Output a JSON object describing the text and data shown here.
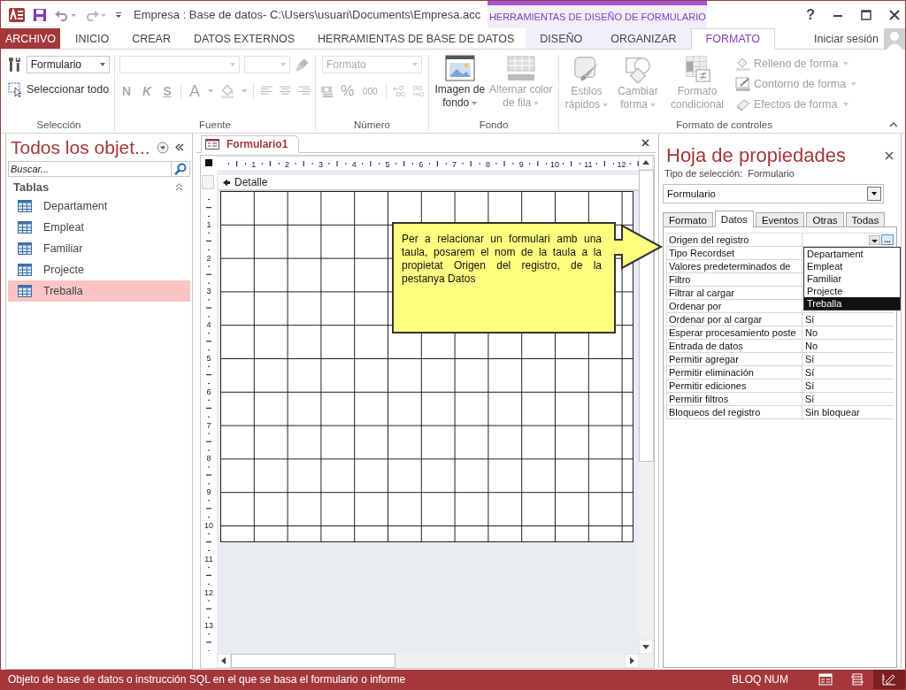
{
  "window": {
    "title": "Empresa : Base de datos- C:\\Users\\usuari\\Documents\\Empresa.acc",
    "context_label": "HERRAMIENTAS DE DISEÑO DE FORMULARIO",
    "help": "?"
  },
  "ribbon_tabs": [
    {
      "label": "ARCHIVO",
      "kind": "file",
      "selected": false
    },
    {
      "label": "INICIO",
      "kind": "main",
      "selected": false
    },
    {
      "label": "CREAR",
      "kind": "main",
      "selected": false
    },
    {
      "label": "DATOS EXTERNOS",
      "kind": "main",
      "selected": false
    },
    {
      "label": "HERRAMIENTAS DE BASE DE DATOS",
      "kind": "main",
      "selected": false
    },
    {
      "label": "DISEÑO",
      "kind": "context",
      "selected": false
    },
    {
      "label": "ORGANIZAR",
      "kind": "context",
      "selected": false
    },
    {
      "label": "FORMATO",
      "kind": "context",
      "selected": true
    }
  ],
  "account": "Iniciar sesión",
  "ribbon": {
    "seleccion": {
      "label": "Selección",
      "combo": "Formulario",
      "select_all": "Seleccionar todo"
    },
    "fuente": {
      "label": "Fuente",
      "style_buttons": [
        "N",
        "K",
        "S"
      ],
      "color_button": "A",
      "disabled": true
    },
    "numero": {
      "label": "Número",
      "combo": "Formato",
      "symbols": [
        "%",
        "000"
      ],
      "disabled": true
    },
    "fondo": {
      "label": "Fondo",
      "buttons": [
        {
          "label": "Imagen de fondo",
          "kind": "image",
          "disabled": false
        },
        {
          "label": "Alternar color de fila",
          "kind": "rows",
          "disabled": true
        }
      ]
    },
    "controles": {
      "label": "Formato de controles",
      "large": [
        {
          "label": "Estilos rápidos",
          "kind": "styles",
          "disabled": true
        },
        {
          "label": "Cambiar forma",
          "kind": "shapes",
          "disabled": true
        },
        {
          "label": "Formato condicional",
          "kind": "conditional",
          "disabled": true
        }
      ],
      "small": [
        {
          "label": "Relleno de forma",
          "kind": "fill",
          "disabled": true
        },
        {
          "label": "Contorno de forma",
          "kind": "outline",
          "disabled": true
        },
        {
          "label": "Efectos de forma",
          "kind": "effects",
          "disabled": true
        }
      ]
    }
  },
  "navigation": {
    "title": "Todos los objet...",
    "search_placeholder": "Buscar...",
    "group": "Tablas",
    "items": [
      {
        "label": "Departament",
        "selected": false
      },
      {
        "label": "Empleat",
        "selected": false
      },
      {
        "label": "Familiar",
        "selected": false
      },
      {
        "label": "Projecte",
        "selected": false
      },
      {
        "label": "Treballa",
        "selected": true
      }
    ]
  },
  "document_tab": "Formulario1",
  "designer": {
    "section": "Detalle",
    "ruler_h": [
      "1",
      "2",
      "3",
      "4",
      "5",
      "6",
      "7",
      "8",
      "9",
      "10",
      "11",
      "12"
    ],
    "ruler_v": [
      "1",
      "2",
      "3",
      "4",
      "5",
      "6",
      "7",
      "8",
      "9",
      "10",
      "11",
      "12",
      "13"
    ]
  },
  "callout": "Per a relacionar un formulari amb una taula, posarem el nom de la taula a la propietat Origen del registro, de la pestanya Datos",
  "property_sheet": {
    "title": "Hoja de propiedades",
    "selection_label": "Tipo de selección:",
    "selection_type": "Formulario",
    "object": "Formulario",
    "tabs": [
      {
        "label": "Formato",
        "selected": false
      },
      {
        "label": "Datos",
        "selected": true
      },
      {
        "label": "Eventos",
        "selected": false
      },
      {
        "label": "Otras",
        "selected": false
      },
      {
        "label": "Todas",
        "selected": false
      }
    ],
    "builder_button": "...",
    "rows": [
      {
        "name": "Origen del registro"
      },
      {
        "name": "Tipo Recordset"
      },
      {
        "name": "Valores predeterminados de"
      },
      {
        "name": "Filtro"
      },
      {
        "name": "Filtrar al cargar"
      },
      {
        "name": "Ordenar por"
      },
      {
        "name": "Ordenar por al cargar",
        "value": "Sí"
      },
      {
        "name": "Esperar procesamiento poste",
        "value": "No"
      },
      {
        "name": "Entrada de datos",
        "value": "No"
      },
      {
        "name": "Permitir agregar",
        "value": "Sí"
      },
      {
        "name": "Permitir eliminación",
        "value": "Sí"
      },
      {
        "name": "Permitir ediciones",
        "value": "Sí"
      },
      {
        "name": "Permitir filtros",
        "value": "Sí"
      },
      {
        "name": "Bloqueos del registro",
        "value": "Sin bloquear"
      }
    ],
    "dropdown": [
      {
        "label": "Departament",
        "selected": false
      },
      {
        "label": "Empleat",
        "selected": false
      },
      {
        "label": "Familiar",
        "selected": false
      },
      {
        "label": "Projecte",
        "selected": false
      },
      {
        "label": "Treballa",
        "selected": true
      }
    ]
  },
  "status_bar": {
    "text": "Objeto de base de datos o instrucción SQL en el que se basa el formulario o informe",
    "indicator": "BLOQ NUM",
    "views": [
      {
        "kind": "form",
        "selected": false
      },
      {
        "kind": "layout",
        "selected": false
      },
      {
        "kind": "design",
        "selected": true
      }
    ]
  }
}
